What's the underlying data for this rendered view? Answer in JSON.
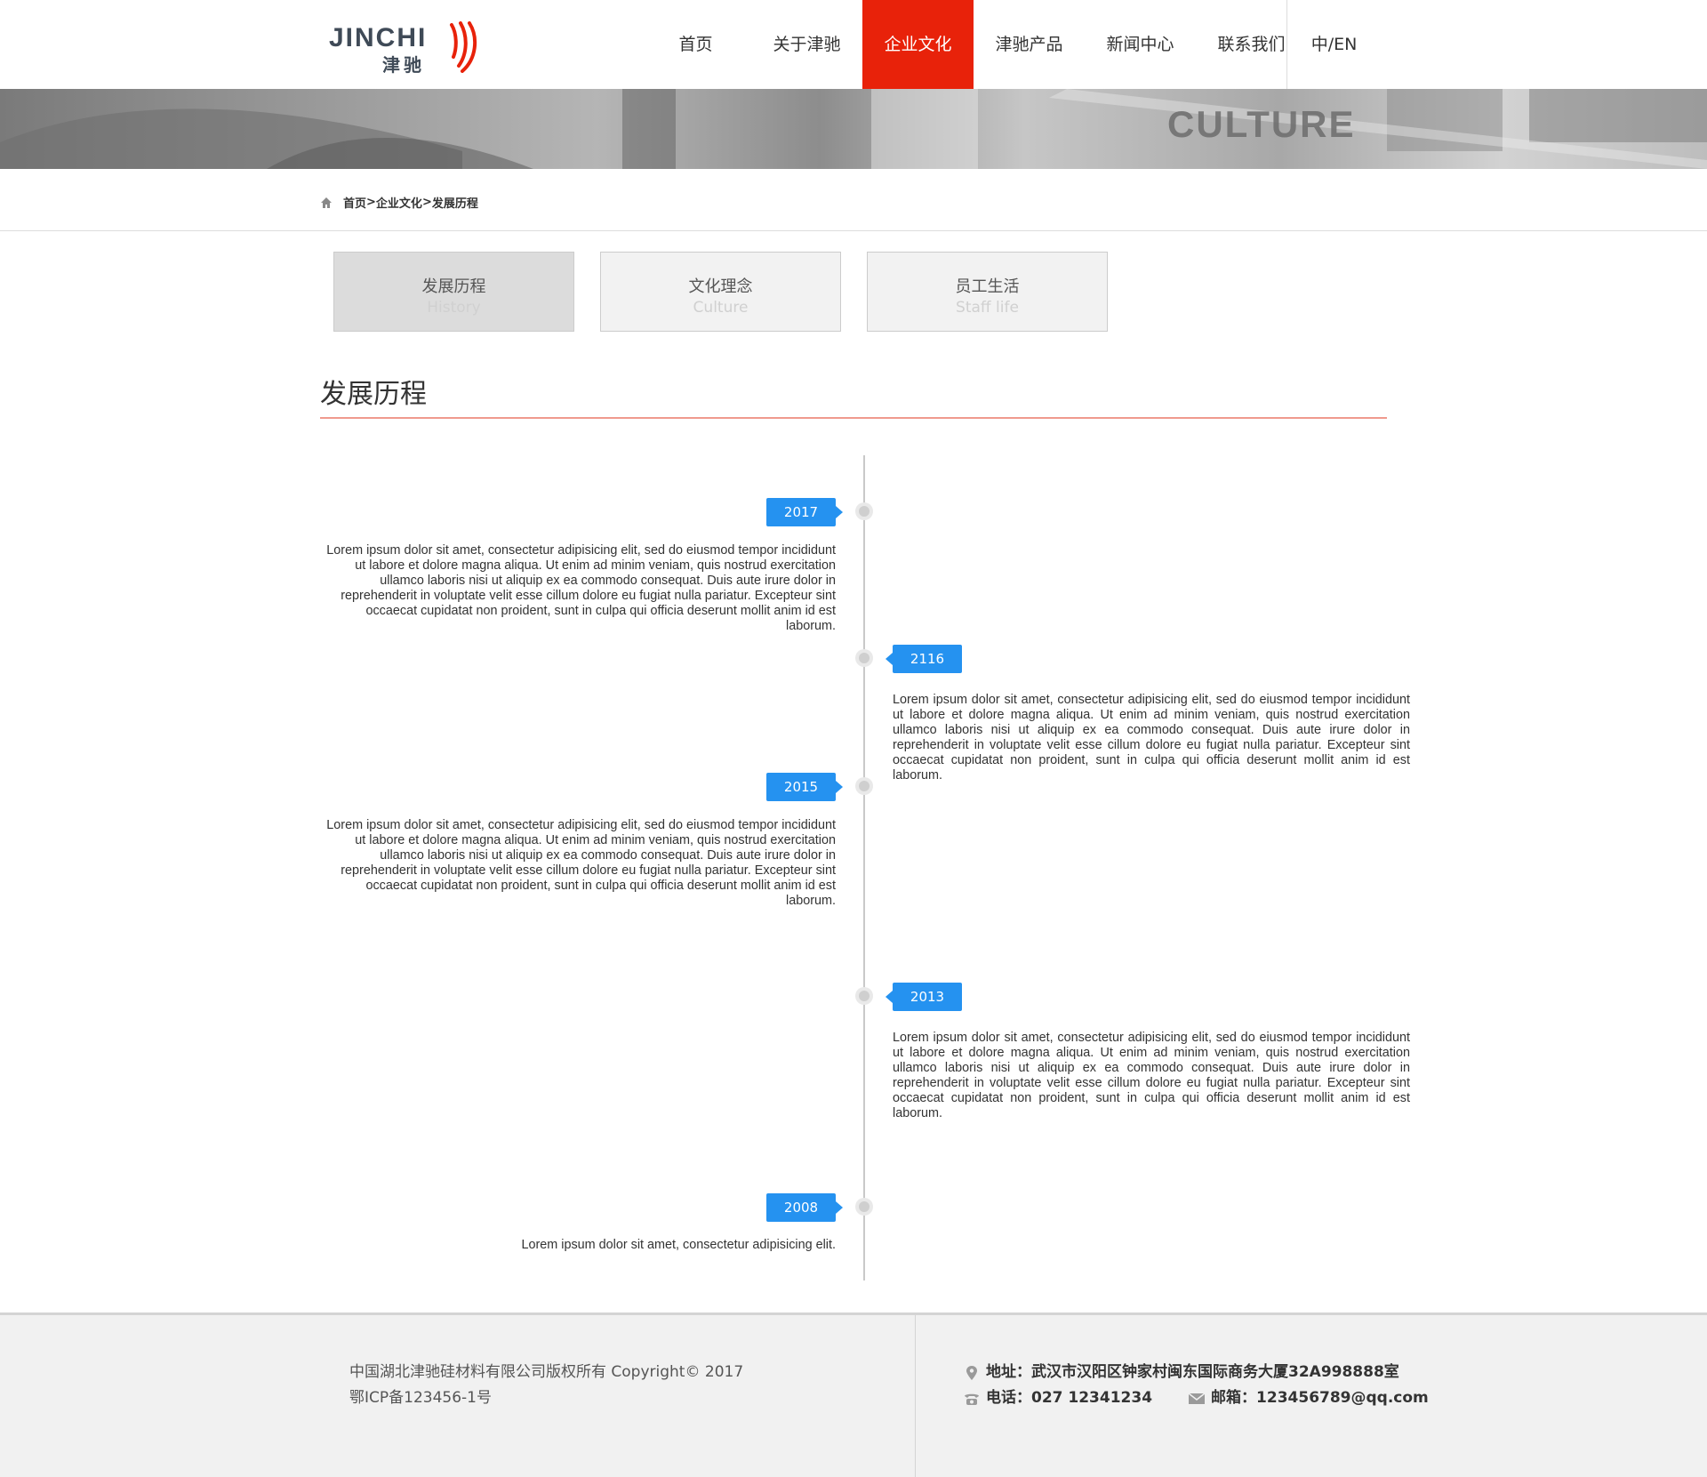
{
  "header": {
    "logo_en": "JINCHI",
    "logo_cn": "津驰",
    "nav": [
      "首页",
      "关于津驰",
      "企业文化",
      "津驰产品",
      "新闻中心",
      "联系我们"
    ],
    "active_index": 2,
    "lang": "中/EN"
  },
  "banner": {
    "word": "CULTURE"
  },
  "breadcrumb": {
    "home": "首页",
    "sep1": ">",
    "section": "企业文化",
    "sep2": ">",
    "current": "发展历程"
  },
  "tabs": [
    {
      "cn": "发展历程",
      "en": "History",
      "active": true
    },
    {
      "cn": "文化理念",
      "en": "Culture",
      "active": false
    },
    {
      "cn": "员工生活",
      "en": "Staff life",
      "active": false
    }
  ],
  "section_title": "发展历程",
  "timeline": [
    {
      "year": "2017",
      "side": "left",
      "text": "Lorem ipsum dolor sit amet, consectetur adipisicing elit, sed do eiusmod tempor incididunt ut labore et dolore magna aliqua. Ut enim ad minim veniam, quis nostrud exercitation ullamco laboris nisi ut aliquip ex ea commodo consequat. Duis aute irure dolor in reprehenderit in voluptate velit esse cillum dolore eu fugiat nulla pariatur. Excepteur sint occaecat cupidatat non proident, sunt in culpa qui officia deserunt mollit anim id est laborum."
    },
    {
      "year": "2116",
      "side": "right",
      "text": "Lorem ipsum dolor sit amet, consectetur adipisicing elit, sed do eiusmod tempor incididunt ut labore et dolore magna aliqua. Ut enim ad minim veniam, quis nostrud exercitation ullamco laboris nisi ut aliquip ex ea commodo consequat. Duis aute irure dolor in reprehenderit in voluptate velit esse cillum dolore eu fugiat nulla pariatur. Excepteur sint occaecat cupidatat non proident, sunt in culpa qui officia deserunt mollit anim id est laborum."
    },
    {
      "year": "2015",
      "side": "left",
      "text": "Lorem ipsum dolor sit amet, consectetur adipisicing elit, sed do eiusmod tempor incididunt ut labore et dolore magna aliqua. Ut enim ad minim veniam, quis nostrud exercitation ullamco laboris nisi ut aliquip ex ea commodo consequat. Duis aute irure dolor in reprehenderit in voluptate velit esse cillum dolore eu fugiat nulla pariatur. Excepteur sint occaecat cupidatat non proident, sunt in culpa qui officia deserunt mollit anim id est laborum."
    },
    {
      "year": "2013",
      "side": "right",
      "text": "Lorem ipsum dolor sit amet, consectetur adipisicing elit, sed do eiusmod tempor incididunt ut labore et dolore magna aliqua. Ut enim ad minim veniam, quis nostrud exercitation ullamco laboris nisi ut aliquip ex ea commodo consequat. Duis aute irure dolor in reprehenderit in voluptate velit esse cillum dolore eu fugiat nulla pariatur. Excepteur sint occaecat cupidatat non proident, sunt in culpa qui officia deserunt mollit anim id est laborum."
    },
    {
      "year": "2008",
      "side": "left",
      "text": "Lorem ipsum dolor sit amet, consectetur adipisicing elit."
    }
  ],
  "footer": {
    "copyright": "中国湖北津驰硅材料有限公司版权所有 Copyright© 2017",
    "icp": "鄂ICP备123456-1号",
    "address": "地址：武汉市汉阳区钟家村闽东国际商务大厦32A998888室",
    "phone": "电话：027 12341234",
    "email": "邮箱：123456789@qq.com"
  },
  "colors": {
    "accent": "#e8220a",
    "year_badge": "#2592f0"
  }
}
